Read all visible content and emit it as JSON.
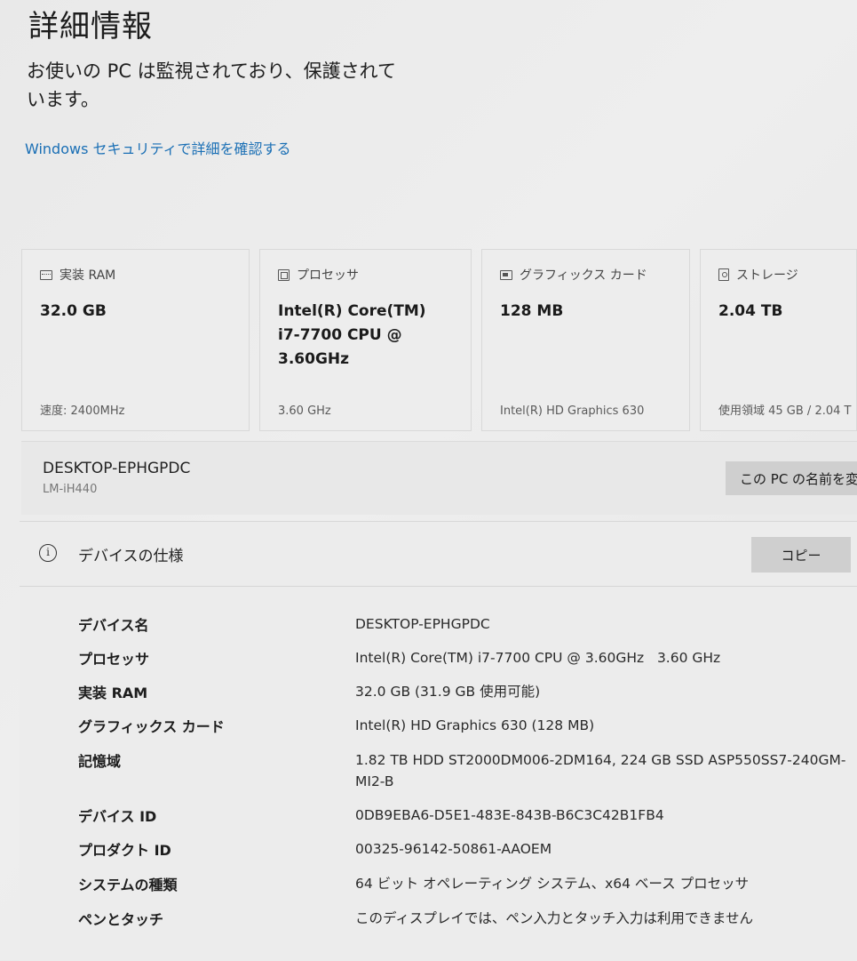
{
  "header": {
    "title": "詳細情報",
    "status": "お使いの PC は監視されており、保護されています。",
    "security_link": "Windows セキュリティで詳細を確認する"
  },
  "cards": [
    {
      "icon": "ram-icon",
      "title": "実装 RAM",
      "value": "32.0 GB",
      "footer": "速度: 2400MHz"
    },
    {
      "icon": "processor-icon",
      "title": "プロセッサ",
      "value": "Intel(R) Core(TM) i7-7700 CPU @ 3.60GHz",
      "footer": "3.60 GHz"
    },
    {
      "icon": "graphics-card-icon",
      "title": "グラフィックス カード",
      "value": "128 MB",
      "footer": "Intel(R) HD Graphics 630"
    },
    {
      "icon": "storage-icon",
      "title": "ストレージ",
      "value": "2.04 TB",
      "footer": "使用領域 45 GB / 2.04 T"
    }
  ],
  "device": {
    "name": "DESKTOP-EPHGPDC",
    "model": "LM-iH440",
    "rename_label": "この PC の名前を変"
  },
  "specs": {
    "title": "デバイスの仕様",
    "copy_label": "コピー",
    "rows": [
      {
        "label": "デバイス名",
        "value": "DESKTOP-EPHGPDC"
      },
      {
        "label": "プロセッサ",
        "value": "Intel(R) Core(TM) i7-7700 CPU @ 3.60GHz   3.60 GHz"
      },
      {
        "label": "実装 RAM",
        "value": "32.0 GB (31.9 GB 使用可能)"
      },
      {
        "label": "グラフィックス カード",
        "value": "Intel(R) HD Graphics 630 (128 MB)"
      },
      {
        "label": "記憶域",
        "value": "1.82 TB HDD ST2000DM006-2DM164, 224 GB SSD ASP550SS7-240GM-MI2-B"
      },
      {
        "label": "デバイス ID",
        "value": "0DB9EBA6-D5E1-483E-843B-B6C3C42B1FB4"
      },
      {
        "label": "プロダクト ID",
        "value": "00325-96142-50861-AAOEM"
      },
      {
        "label": "システムの種類",
        "value": "64 ビット オペレーティング システム、x64 ベース プロセッサ"
      },
      {
        "label": "ペンとタッチ",
        "value": "このディスプレイでは、ペン入力とタッチ入力は利用できません"
      }
    ]
  }
}
